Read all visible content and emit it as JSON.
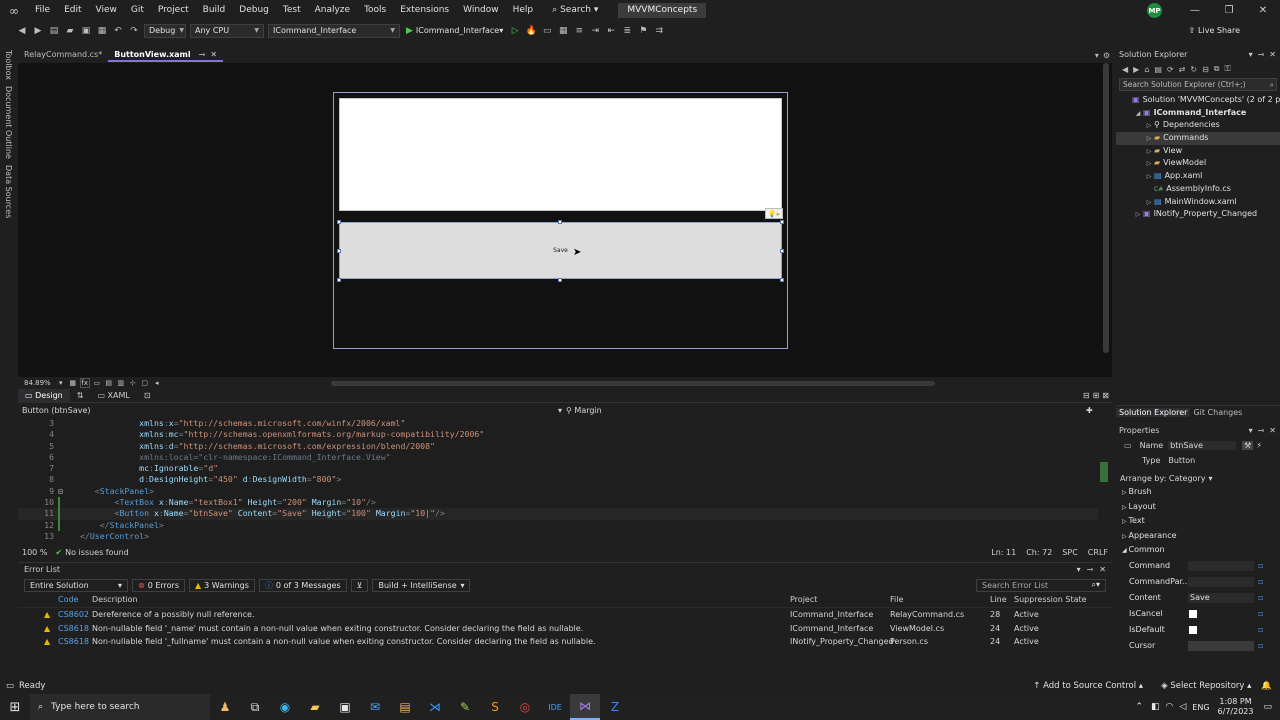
{
  "menu": {
    "items": [
      "File",
      "Edit",
      "View",
      "Git",
      "Project",
      "Build",
      "Debug",
      "Test",
      "Analyze",
      "Tools",
      "Extensions",
      "Window",
      "Help"
    ],
    "search": "Search",
    "project_title": "MVVMConcepts",
    "avatar": "MP"
  },
  "toolbar": {
    "config": "Debug",
    "platform": "Any CPU",
    "startup_project": "ICommand_Interface",
    "run_label": "ICommand_Interface",
    "live_share": "Live Share"
  },
  "left_strip": [
    "Toolbox",
    "Document Outline",
    "Data Sources"
  ],
  "doc_tabs": [
    {
      "label": "RelayCommand.cs*"
    },
    {
      "label": "ButtonView.xaml"
    }
  ],
  "designer": {
    "button_content": "Save"
  },
  "zoom": {
    "level": "84.89%",
    "fx": "fx"
  },
  "split": {
    "design": "Design",
    "xaml": "XAML",
    "swap": "⇅"
  },
  "pathbar": {
    "element": "Button (btnSave)",
    "property": "Margin"
  },
  "code_lines": [
    {
      "n": "3",
      "parts": [
        [
          "            ",
          ""
        ],
        [
          "xmlns",
          "t-attr"
        ],
        [
          ":",
          "t-punc"
        ],
        [
          "x",
          "t-attr"
        ],
        [
          "=",
          "t-punc"
        ],
        [
          "\"http://schemas.microsoft.com/winfx/2006/xaml\"",
          "t-str"
        ]
      ]
    },
    {
      "n": "4",
      "parts": [
        [
          "            ",
          ""
        ],
        [
          "xmlns",
          "t-attr"
        ],
        [
          ":",
          "t-punc"
        ],
        [
          "mc",
          "t-attr"
        ],
        [
          "=",
          "t-punc"
        ],
        [
          "\"http://schemas.openxmlformats.org/markup-compatibility/2006\"",
          "t-str"
        ]
      ]
    },
    {
      "n": "5",
      "parts": [
        [
          "            ",
          ""
        ],
        [
          "xmlns",
          "t-attr"
        ],
        [
          ":",
          "t-punc"
        ],
        [
          "d",
          "t-attr"
        ],
        [
          "=",
          "t-punc"
        ],
        [
          "\"http://schemas.microsoft.com/expression/blend/2008\"",
          "t-str"
        ]
      ]
    },
    {
      "n": "6",
      "parts": [
        [
          "            ",
          ""
        ],
        [
          "xmlns:local=\"clr-namespace:ICommand_Interface.View\"",
          "t-dim"
        ]
      ]
    },
    {
      "n": "7",
      "parts": [
        [
          "            ",
          ""
        ],
        [
          "mc",
          "t-attr"
        ],
        [
          ":",
          "t-punc"
        ],
        [
          "Ignorable",
          "t-attr"
        ],
        [
          "=",
          "t-punc"
        ],
        [
          "\"d\"",
          "t-str"
        ]
      ]
    },
    {
      "n": "8",
      "parts": [
        [
          "            ",
          ""
        ],
        [
          "d",
          "t-attr"
        ],
        [
          ":",
          "t-punc"
        ],
        [
          "DesignHeight",
          "t-attr"
        ],
        [
          "=",
          "t-punc"
        ],
        [
          "\"450\"",
          "t-str"
        ],
        [
          " d",
          "t-attr"
        ],
        [
          ":",
          "t-punc"
        ],
        [
          "DesignWidth",
          "t-attr"
        ],
        [
          "=",
          "t-punc"
        ],
        [
          "\"800\"",
          "t-str"
        ],
        [
          ">",
          "t-punc"
        ]
      ]
    },
    {
      "n": "9",
      "parts": [
        [
          "   ",
          ""
        ],
        [
          "<",
          "t-punc"
        ],
        [
          "StackPanel",
          "t-tag"
        ],
        [
          ">",
          "t-punc"
        ]
      ]
    },
    {
      "n": "10",
      "parts": [
        [
          "       ",
          ""
        ],
        [
          "<",
          "t-punc"
        ],
        [
          "TextBox",
          "t-tag"
        ],
        [
          " x",
          "t-attr"
        ],
        [
          ":",
          "t-punc"
        ],
        [
          "Name",
          "t-attr"
        ],
        [
          "=",
          "t-punc"
        ],
        [
          "\"textBox1\"",
          "t-str"
        ],
        [
          " Height",
          "t-attr"
        ],
        [
          "=",
          "t-punc"
        ],
        [
          "\"200\"",
          "t-str"
        ],
        [
          " Margin",
          "t-attr"
        ],
        [
          "=",
          "t-punc"
        ],
        [
          "\"10\"",
          "t-str"
        ],
        [
          "/>",
          "t-punc"
        ]
      ]
    },
    {
      "n": "11",
      "parts": [
        [
          "       ",
          ""
        ],
        [
          "<",
          "t-punc"
        ],
        [
          "Button",
          "t-tag"
        ],
        [
          " x",
          "t-attr"
        ],
        [
          ":",
          "t-punc"
        ],
        [
          "Name",
          "t-attr"
        ],
        [
          "=",
          "t-punc"
        ],
        [
          "\"btnSave\"",
          "t-str"
        ],
        [
          " Content",
          "t-attr"
        ],
        [
          "=",
          "t-punc"
        ],
        [
          "\"Save\"",
          "t-str"
        ],
        [
          " Height",
          "t-attr"
        ],
        [
          "=",
          "t-punc"
        ],
        [
          "\"100\"",
          "t-str"
        ],
        [
          " Margin",
          "t-attr"
        ],
        [
          "=",
          "t-punc"
        ],
        [
          "\"10|\"",
          "t-str"
        ],
        [
          "/>",
          "t-punc"
        ]
      ]
    },
    {
      "n": "12",
      "parts": [
        [
          "    ",
          ""
        ],
        [
          "</",
          "t-punc"
        ],
        [
          "StackPanel",
          "t-tag"
        ],
        [
          ">",
          "t-punc"
        ]
      ]
    },
    {
      "n": "13",
      "parts": [
        [
          "",
          ""
        ],
        [
          "</",
          "t-punc"
        ],
        [
          "UserControl",
          "t-tag"
        ],
        [
          ">",
          "t-punc"
        ]
      ]
    }
  ],
  "editor_status": {
    "zoom": "100 %",
    "issues": "No issues found",
    "ln": "Ln: 11",
    "ch": "Ch: 72",
    "spc": "SPC",
    "crlf": "CRLF"
  },
  "error_list": {
    "title": "Error List",
    "scope": "Entire Solution",
    "errors": "0 Errors",
    "warnings": "3 Warnings",
    "messages": "0 of 3 Messages",
    "build_filter": "Build + IntelliSense",
    "search_placeholder": "Search Error List",
    "headers": {
      "code": "Code",
      "description": "Description",
      "project": "Project",
      "file": "File",
      "line": "Line",
      "suppression": "Suppression State"
    },
    "rows": [
      {
        "code": "CS8602",
        "description": "Dereference of a possibly null reference.",
        "project": "ICommand_Interface",
        "file": "RelayCommand.cs",
        "line": "28",
        "suppression": "Active"
      },
      {
        "code": "CS8618",
        "description": "Non-nullable field '_name' must contain a non-null value when exiting constructor. Consider declaring the field as nullable.",
        "project": "ICommand_Interface",
        "file": "ViewModel.cs",
        "line": "24",
        "suppression": "Active"
      },
      {
        "code": "CS8618",
        "description": "Non-nullable field '_fullname' must contain a non-null value when exiting constructor. Consider declaring the field as nullable.",
        "project": "INotify_Property_Changed",
        "file": "Person.cs",
        "line": "24",
        "suppression": "Active"
      }
    ]
  },
  "solution_explorer": {
    "title": "Solution Explorer",
    "search_placeholder": "Search Solution Explorer (Ctrl+;)",
    "items": [
      {
        "label": "Solution 'MVVMConcepts' (2 of 2 projects)",
        "indent": 0,
        "exp": "",
        "icon": "proj"
      },
      {
        "label": "ICommand_Interface",
        "indent": 1,
        "exp": "◢",
        "icon": "proj",
        "bold": true
      },
      {
        "label": "Dependencies",
        "indent": 2,
        "exp": "▷",
        "icon": "dep"
      },
      {
        "label": "Commands",
        "indent": 2,
        "exp": "▷",
        "icon": "folder",
        "selected": true
      },
      {
        "label": "View",
        "indent": 2,
        "exp": "▷",
        "icon": "folder"
      },
      {
        "label": "ViewModel",
        "indent": 2,
        "exp": "▷",
        "icon": "folder"
      },
      {
        "label": "App.xaml",
        "indent": 2,
        "exp": "▷",
        "icon": "xaml"
      },
      {
        "label": "AssemblyInfo.cs",
        "indent": 2,
        "exp": "",
        "icon": "cs"
      },
      {
        "label": "MainWindow.xaml",
        "indent": 2,
        "exp": "▷",
        "icon": "xaml"
      },
      {
        "label": "INotify_Property_Changed",
        "indent": 1,
        "exp": "▷",
        "icon": "proj"
      }
    ],
    "tab_active": "Solution Explorer",
    "tab_other": "Git Changes"
  },
  "properties": {
    "title": "Properties",
    "name_label": "Name",
    "name_value": "btnSave",
    "type_label": "Type",
    "type_value": "Button",
    "arrange_by": "Arrange by: Category",
    "categories": [
      "Brush",
      "Layout",
      "Text",
      "Appearance",
      "Common"
    ],
    "common_props": [
      {
        "name": "Command",
        "value": "",
        "kind": "text"
      },
      {
        "name": "CommandPar...",
        "value": "",
        "kind": "text"
      },
      {
        "name": "Content",
        "value": "Save",
        "kind": "text"
      },
      {
        "name": "IsCancel",
        "value": "",
        "kind": "check"
      },
      {
        "name": "IsDefault",
        "value": "",
        "kind": "check"
      },
      {
        "name": "Cursor",
        "value": "",
        "kind": "combo"
      }
    ]
  },
  "statusbar": {
    "ready": "Ready",
    "source_control": "Add to Source Control",
    "repository": "Select Repository"
  },
  "taskbar": {
    "search_placeholder": "Type here to search",
    "lang": "ENG",
    "time": "1:08 PM",
    "date": "6/7/2023"
  }
}
